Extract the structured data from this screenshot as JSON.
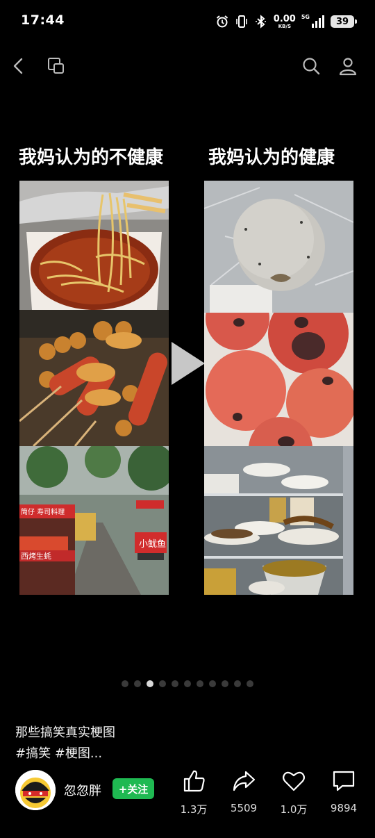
{
  "status_bar": {
    "time": "17:44",
    "net_speed": "0.00",
    "net_unit": "KB/S",
    "network": "5G",
    "battery": "39"
  },
  "post": {
    "left_title": "我妈认为的不健康",
    "right_title": "我妈认为的健康",
    "page_count": 11,
    "active_page": 2,
    "title": "那些搞笑真实梗图",
    "tags": "#搞笑 #梗图..."
  },
  "author": {
    "name": "忽忽胖",
    "follow_label": "+关注"
  },
  "actions": {
    "likes": "1.3万",
    "shares": "5509",
    "favorites": "1.0万",
    "comments": "9894"
  },
  "colors": {
    "background": "#000000",
    "follow_button": "#1fb952"
  },
  "icons": [
    "alarm-icon",
    "vibrate-icon",
    "bluetooth-icon",
    "signal-icon",
    "battery-icon",
    "back-icon",
    "copy-window-icon",
    "search-icon",
    "profile-icon",
    "thumb-up-icon",
    "share-arrow-icon",
    "heart-icon",
    "comment-icon",
    "play-icon"
  ]
}
